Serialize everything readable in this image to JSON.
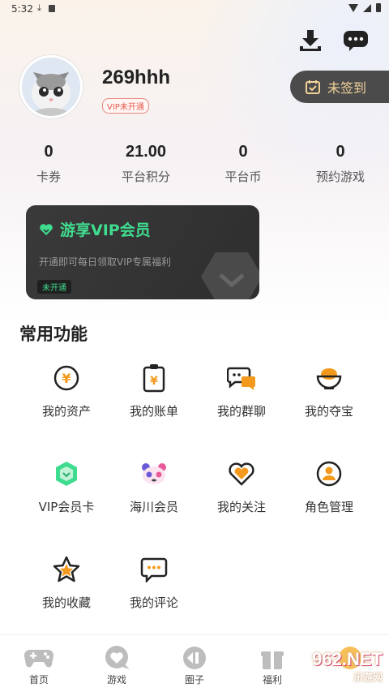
{
  "status_bar": {
    "time": "5:32"
  },
  "profile": {
    "username": "269hhh",
    "vip_status": "VIP未开通",
    "signin_label": "未签到"
  },
  "stats": [
    {
      "value": "0",
      "label": "卡券"
    },
    {
      "value": "21.00",
      "label": "平台积分"
    },
    {
      "value": "0",
      "label": "平台币"
    },
    {
      "value": "0",
      "label": "预约游戏"
    }
  ],
  "vip_card": {
    "title": "游享VIP会员",
    "description": "开通即可每日领取VIP专属福利",
    "badge": "未开通"
  },
  "common_functions": {
    "title": "常用功能",
    "items": [
      {
        "label": "我的资产",
        "icon": "yen-coin-icon"
      },
      {
        "label": "我的账单",
        "icon": "bill-icon"
      },
      {
        "label": "我的群聊",
        "icon": "group-chat-icon"
      },
      {
        "label": "我的夺宝",
        "icon": "treasure-bowl-icon"
      },
      {
        "label": "VIP会员卡",
        "icon": "vip-card-icon"
      },
      {
        "label": "海川会员",
        "icon": "panda-icon"
      },
      {
        "label": "我的关注",
        "icon": "heart-icon"
      },
      {
        "label": "角色管理",
        "icon": "user-role-icon"
      },
      {
        "label": "我的收藏",
        "icon": "star-icon"
      },
      {
        "label": "我的评论",
        "icon": "comment-icon"
      }
    ]
  },
  "bottom_nav": [
    {
      "label": "首页",
      "icon": "gamepad-icon"
    },
    {
      "label": "游戏",
      "icon": "heart-bubble-icon"
    },
    {
      "label": "圈子",
      "icon": "circle-icon"
    },
    {
      "label": "福利",
      "icon": "gift-icon"
    }
  ],
  "watermark": {
    "main": "962.NET",
    "sub": "乐游网"
  },
  "colors": {
    "accent_orange": "#f39a1e",
    "vip_green": "#3fdc8f",
    "signin_bg": "#4b4b4b",
    "signin_text": "#f3d29a",
    "vip_tag_red": "#e85a4f"
  }
}
